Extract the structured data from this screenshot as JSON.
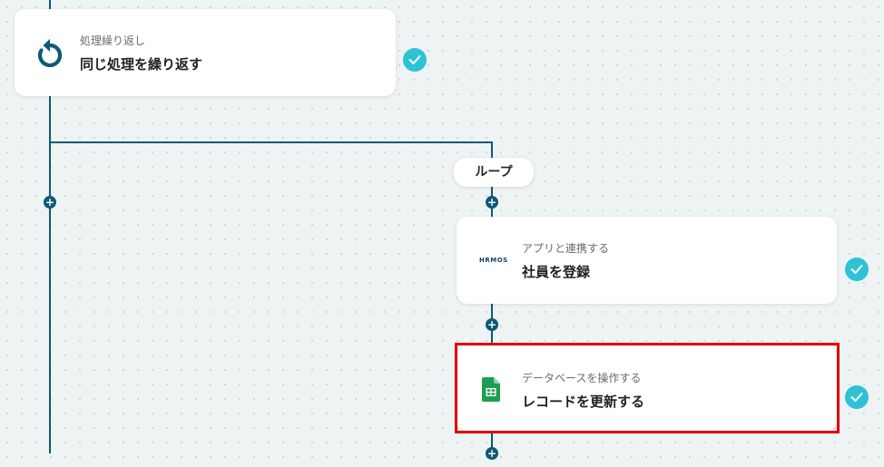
{
  "loop_card": {
    "subtitle": "処理繰り返し",
    "title": "同じ処理を繰り返す"
  },
  "loop_badge": {
    "label": "ループ"
  },
  "hrmos_card": {
    "subtitle": "アプリと連携する",
    "title": "社員を登録",
    "logo_text": "HRMOS"
  },
  "sheet_card": {
    "subtitle": "データベースを操作する",
    "title": "レコードを更新する"
  },
  "add_step_symbol": "+",
  "colors": {
    "connector": "#0d5a74",
    "check": "#2ec2d6",
    "selection": "#e20000",
    "sheets_green": "#1e9e4f"
  }
}
